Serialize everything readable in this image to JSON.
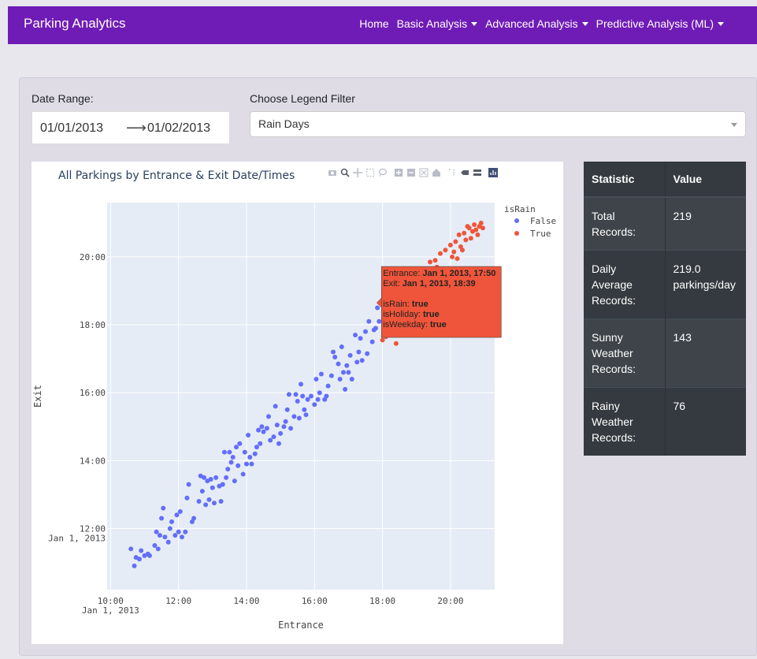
{
  "navbar": {
    "brand": "Parking Analytics",
    "links": [
      {
        "label": "Home",
        "dropdown": false
      },
      {
        "label": "Basic Analysis",
        "dropdown": true
      },
      {
        "label": "Advanced Analysis",
        "dropdown": true
      },
      {
        "label": "Predictive Analysis (ML)",
        "dropdown": true
      }
    ],
    "color": "#6f1bb5"
  },
  "filters": {
    "date_range_label": "Date Range:",
    "start_date": "01/01/2013",
    "end_date": "01/02/2013",
    "legend_label": "Choose Legend Filter",
    "legend_value": "Rain Days"
  },
  "stats": {
    "headers": [
      "Statistic",
      "Value"
    ],
    "rows": [
      {
        "stat": "Total Records:",
        "value": "219"
      },
      {
        "stat": "Daily Average Records:",
        "value": "219.0 parkings/day"
      },
      {
        "stat": "Sunny Weather Records:",
        "value": "143"
      },
      {
        "stat": "Rainy Weather Records:",
        "value": "76"
      }
    ]
  },
  "chart_data": {
    "type": "scatter",
    "title": "All Parkings by Entrance & Exit Date/Times",
    "xlabel": "Entrance",
    "ylabel": "Exit",
    "x_ticks": [
      "10:00",
      "12:00",
      "14:00",
      "16:00",
      "18:00",
      "20:00"
    ],
    "x_tick_sub": "Jan 1, 2013",
    "y_ticks": [
      "12:00",
      "14:00",
      "16:00",
      "18:00",
      "20:00"
    ],
    "y_tick_sub": "Jan 1, 2013",
    "xlim": [
      9.9,
      21.3
    ],
    "ylim": [
      10.2,
      21.6
    ],
    "legend_title": "isRain",
    "legend_position": "top-right",
    "series": [
      {
        "name": "False",
        "color": "#636efa",
        "points": [
          [
            10.6,
            11.4
          ],
          [
            10.7,
            10.9
          ],
          [
            10.75,
            11.15
          ],
          [
            10.85,
            11.1
          ],
          [
            10.9,
            11.35
          ],
          [
            11.0,
            11.2
          ],
          [
            11.1,
            11.25
          ],
          [
            11.15,
            11.2
          ],
          [
            11.3,
            11.5
          ],
          [
            11.35,
            11.9
          ],
          [
            11.4,
            11.4
          ],
          [
            11.45,
            11.8
          ],
          [
            11.5,
            12.3
          ],
          [
            11.55,
            12.6
          ],
          [
            11.6,
            11.75
          ],
          [
            11.7,
            11.6
          ],
          [
            11.75,
            12.0
          ],
          [
            11.8,
            12.2
          ],
          [
            11.9,
            11.8
          ],
          [
            11.95,
            12.4
          ],
          [
            12.0,
            11.9
          ],
          [
            12.05,
            12.5
          ],
          [
            12.1,
            11.75
          ],
          [
            12.2,
            11.9
          ],
          [
            12.25,
            12.9
          ],
          [
            12.3,
            13.3
          ],
          [
            12.4,
            12.2
          ],
          [
            12.45,
            12.3
          ],
          [
            12.6,
            12.8
          ],
          [
            12.65,
            13.55
          ],
          [
            12.7,
            13.1
          ],
          [
            12.75,
            13.5
          ],
          [
            12.8,
            12.7
          ],
          [
            12.85,
            13.4
          ],
          [
            12.9,
            12.85
          ],
          [
            12.95,
            13.45
          ],
          [
            13.0,
            13.2
          ],
          [
            13.05,
            12.75
          ],
          [
            13.1,
            13.5
          ],
          [
            13.2,
            13.25
          ],
          [
            13.25,
            12.8
          ],
          [
            13.3,
            13.3
          ],
          [
            13.35,
            14.25
          ],
          [
            13.4,
            13.5
          ],
          [
            13.45,
            13.75
          ],
          [
            13.5,
            14.25
          ],
          [
            13.55,
            13.95
          ],
          [
            13.6,
            14.1
          ],
          [
            13.65,
            13.4
          ],
          [
            13.7,
            14.4
          ],
          [
            13.75,
            13.85
          ],
          [
            13.8,
            14.5
          ],
          [
            13.9,
            13.6
          ],
          [
            13.95,
            14.25
          ],
          [
            14.0,
            13.9
          ],
          [
            14.05,
            14.75
          ],
          [
            14.1,
            14.1
          ],
          [
            14.15,
            13.9
          ],
          [
            14.25,
            14.2
          ],
          [
            14.3,
            14.4
          ],
          [
            14.35,
            14.9
          ],
          [
            14.4,
            14.5
          ],
          [
            14.45,
            15.0
          ],
          [
            14.5,
            14.85
          ],
          [
            14.6,
            14.95
          ],
          [
            14.65,
            15.3
          ],
          [
            14.7,
            14.6
          ],
          [
            14.8,
            14.7
          ],
          [
            14.85,
            15.6
          ],
          [
            14.9,
            15.05
          ],
          [
            14.95,
            14.5
          ],
          [
            15.0,
            14.8
          ],
          [
            15.1,
            15.0
          ],
          [
            15.15,
            15.15
          ],
          [
            15.2,
            15.5
          ],
          [
            15.25,
            15.95
          ],
          [
            15.3,
            14.95
          ],
          [
            15.4,
            15.3
          ],
          [
            15.45,
            15.95
          ],
          [
            15.5,
            15.75
          ],
          [
            15.55,
            15.25
          ],
          [
            15.6,
            16.25
          ],
          [
            15.65,
            15.9
          ],
          [
            15.7,
            15.5
          ],
          [
            15.75,
            15.35
          ],
          [
            15.8,
            15.8
          ],
          [
            15.9,
            15.9
          ],
          [
            16.0,
            15.65
          ],
          [
            16.05,
            16.4
          ],
          [
            16.1,
            15.8
          ],
          [
            16.15,
            16.0
          ],
          [
            16.2,
            16.55
          ],
          [
            16.3,
            15.8
          ],
          [
            16.35,
            15.9
          ],
          [
            16.4,
            16.2
          ],
          [
            16.5,
            16.5
          ],
          [
            16.55,
            17.2
          ],
          [
            16.6,
            17.05
          ],
          [
            16.7,
            16.85
          ],
          [
            16.75,
            16.4
          ],
          [
            16.8,
            17.35
          ],
          [
            16.85,
            16.6
          ],
          [
            16.9,
            16.1
          ],
          [
            16.95,
            16.8
          ],
          [
            17.0,
            16.6
          ],
          [
            17.05,
            17.1
          ],
          [
            17.1,
            16.4
          ],
          [
            17.2,
            17.7
          ],
          [
            17.25,
            16.9
          ],
          [
            17.3,
            17.2
          ],
          [
            17.35,
            17.6
          ],
          [
            17.4,
            16.95
          ],
          [
            17.5,
            17.8
          ],
          [
            17.55,
            17.15
          ],
          [
            17.6,
            18.1
          ],
          [
            17.7,
            17.5
          ],
          [
            17.75,
            17.85
          ],
          [
            17.8,
            17.9
          ],
          [
            17.85,
            18.5
          ],
          [
            17.9,
            18.1
          ]
        ]
      },
      {
        "name": "True",
        "color": "#ef553b",
        "points": [
          [
            18.0,
            17.55
          ],
          [
            18.1,
            17.65
          ],
          [
            18.2,
            18.0
          ],
          [
            18.3,
            18.45
          ],
          [
            18.35,
            18.6
          ],
          [
            18.4,
            17.45
          ],
          [
            18.5,
            18.3
          ],
          [
            18.55,
            18.05
          ],
          [
            18.6,
            18.4
          ],
          [
            18.7,
            18.25
          ],
          [
            18.8,
            19.2
          ],
          [
            18.85,
            18.1
          ],
          [
            18.9,
            18.75
          ],
          [
            19.0,
            19.1
          ],
          [
            19.05,
            18.7
          ],
          [
            19.1,
            18.4
          ],
          [
            19.15,
            19.4
          ],
          [
            19.25,
            18.6
          ],
          [
            19.3,
            19.55
          ],
          [
            19.35,
            18.95
          ],
          [
            19.4,
            19.85
          ],
          [
            19.5,
            19.2
          ],
          [
            19.55,
            19.9
          ],
          [
            19.6,
            19.7
          ],
          [
            19.7,
            20.1
          ],
          [
            19.8,
            19.35
          ],
          [
            19.85,
            20.2
          ],
          [
            19.9,
            19.65
          ],
          [
            20.0,
            20.35
          ],
          [
            20.05,
            20.0
          ],
          [
            20.1,
            20.15
          ],
          [
            20.15,
            20.45
          ],
          [
            20.2,
            19.95
          ],
          [
            20.25,
            20.65
          ],
          [
            20.3,
            20.3
          ],
          [
            20.35,
            20.2
          ],
          [
            20.4,
            20.7
          ],
          [
            20.45,
            20.5
          ],
          [
            20.5,
            20.9
          ],
          [
            20.55,
            20.85
          ],
          [
            20.6,
            20.55
          ],
          [
            20.65,
            20.75
          ],
          [
            20.7,
            20.95
          ],
          [
            20.75,
            20.8
          ],
          [
            20.8,
            20.65
          ],
          [
            20.85,
            20.9
          ],
          [
            20.9,
            21.0
          ],
          [
            20.95,
            20.85
          ]
        ]
      }
    ],
    "hover_tooltip": {
      "lines": [
        {
          "label": "Entrance: ",
          "value": "Jan 1, 2013, 17:50"
        },
        {
          "label": "Exit: ",
          "value": "Jan 1, 2013, 18:39"
        },
        {
          "label": "",
          "value": ""
        },
        {
          "label": "isRain: ",
          "value": "true"
        },
        {
          "label": "isHoliday: ",
          "value": "true"
        },
        {
          "label": "isWeekday: ",
          "value": "true"
        }
      ],
      "point": [
        17.83,
        18.65
      ]
    }
  }
}
